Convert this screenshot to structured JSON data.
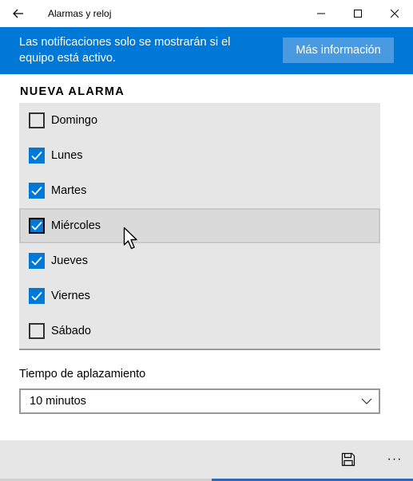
{
  "window": {
    "title": "Alarmas y reloj"
  },
  "banner": {
    "message": "Las notificaciones solo se mostrarán si el equipo está activo.",
    "button_label": "Más información"
  },
  "section_title": "NUEVA ALARMA",
  "days": [
    {
      "label": "Domingo",
      "checked": false
    },
    {
      "label": "Lunes",
      "checked": true
    },
    {
      "label": "Martes",
      "checked": true
    },
    {
      "label": "Miércoles",
      "checked": true
    },
    {
      "label": "Jueves",
      "checked": true
    },
    {
      "label": "Viernes",
      "checked": true
    },
    {
      "label": "Sábado",
      "checked": false
    }
  ],
  "snooze": {
    "label": "Tiempo de aplazamiento",
    "value": "10 minutos"
  },
  "bottom": {
    "more_label": "···"
  },
  "colors": {
    "accent": "#0078d7"
  }
}
